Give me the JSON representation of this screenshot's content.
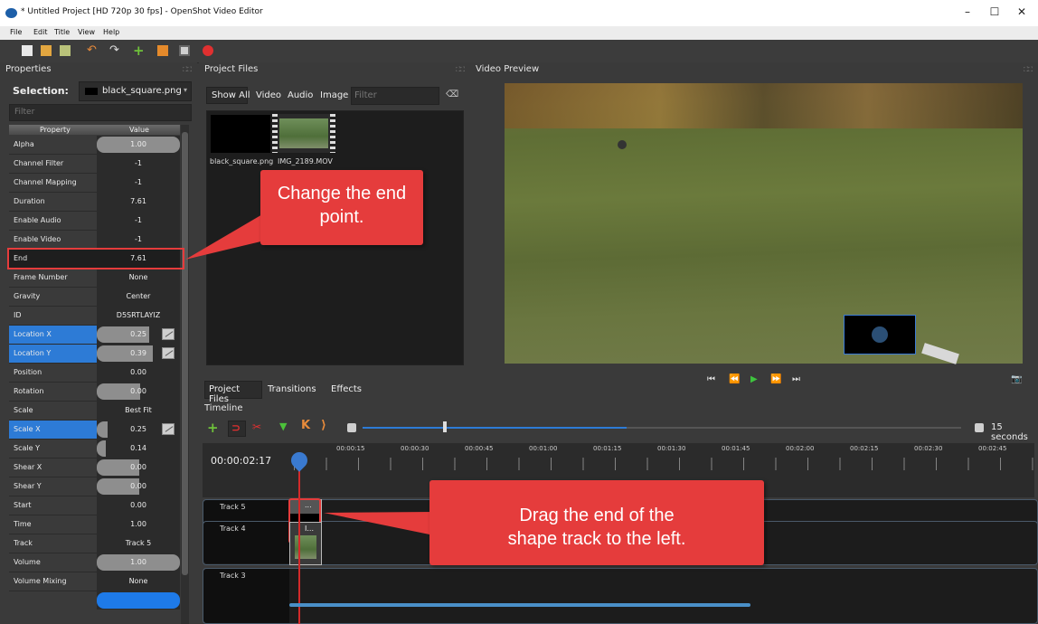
{
  "window": {
    "title": "* Untitled Project [HD 720p 30 fps] - OpenShot Video Editor",
    "minimize": "–",
    "maximize": "☐",
    "close": "✕"
  },
  "menu": [
    "File",
    "Edit",
    "Title",
    "View",
    "Help"
  ],
  "properties": {
    "header": "Properties",
    "selection_label": "Selection:",
    "selection_value": "black_square.png",
    "filter_placeholder": "Filter",
    "col_property": "Property",
    "col_value": "Value",
    "rows": [
      {
        "name": "Alpha",
        "value": "1.00"
      },
      {
        "name": "Channel Filter",
        "value": "-1"
      },
      {
        "name": "Channel Mapping",
        "value": "-1"
      },
      {
        "name": "Duration",
        "value": "7.61"
      },
      {
        "name": "Enable Audio",
        "value": "-1"
      },
      {
        "name": "Enable Video",
        "value": "-1"
      },
      {
        "name": "End",
        "value": "7.61"
      },
      {
        "name": "Frame Number",
        "value": "None"
      },
      {
        "name": "Gravity",
        "value": "Center"
      },
      {
        "name": "ID",
        "value": "D5SRTLAYIZ"
      },
      {
        "name": "Location X",
        "value": "0.25"
      },
      {
        "name": "Location Y",
        "value": "0.39"
      },
      {
        "name": "Position",
        "value": "0.00"
      },
      {
        "name": "Rotation",
        "value": "0.00"
      },
      {
        "name": "Scale",
        "value": "Best Fit"
      },
      {
        "name": "Scale X",
        "value": "0.25"
      },
      {
        "name": "Scale Y",
        "value": "0.14"
      },
      {
        "name": "Shear X",
        "value": "0.00"
      },
      {
        "name": "Shear Y",
        "value": "0.00"
      },
      {
        "name": "Start",
        "value": "0.00"
      },
      {
        "name": "Time",
        "value": "1.00"
      },
      {
        "name": "Track",
        "value": "Track 5"
      },
      {
        "name": "Volume",
        "value": "1.00"
      },
      {
        "name": "Volume Mixing",
        "value": "None"
      }
    ]
  },
  "project_files": {
    "header": "Project Files",
    "filters": [
      "Show All",
      "Video",
      "Audio",
      "Image"
    ],
    "search_placeholder": "Filter",
    "files": [
      "black_square.png",
      "IMG_2189.MOV"
    ],
    "tabs": [
      "Project Files",
      "Transitions",
      "Effects"
    ]
  },
  "preview": {
    "header": "Video Preview"
  },
  "timeline": {
    "header": "Timeline",
    "timecode": "00:00:02:17",
    "zoom_label": "15 seconds",
    "ruler": [
      "00:00:15",
      "00:00:30",
      "00:00:45",
      "00:01:00",
      "00:01:15",
      "00:01:30",
      "00:01:45",
      "00:02:00",
      "00:02:15",
      "00:02:30",
      "00:02:45"
    ],
    "tracks": [
      "Track 5",
      "Track 4",
      "Track 3"
    ],
    "clip_labels": [
      "...",
      "I..."
    ]
  },
  "callouts": {
    "end_point": "Change the end point.",
    "drag_end": "Drag the end of the shape track to the left."
  },
  "colors": {
    "accent_blue": "#2d7bd6",
    "callout_red": "#e53c3c",
    "playhead": "#d42a2a"
  }
}
